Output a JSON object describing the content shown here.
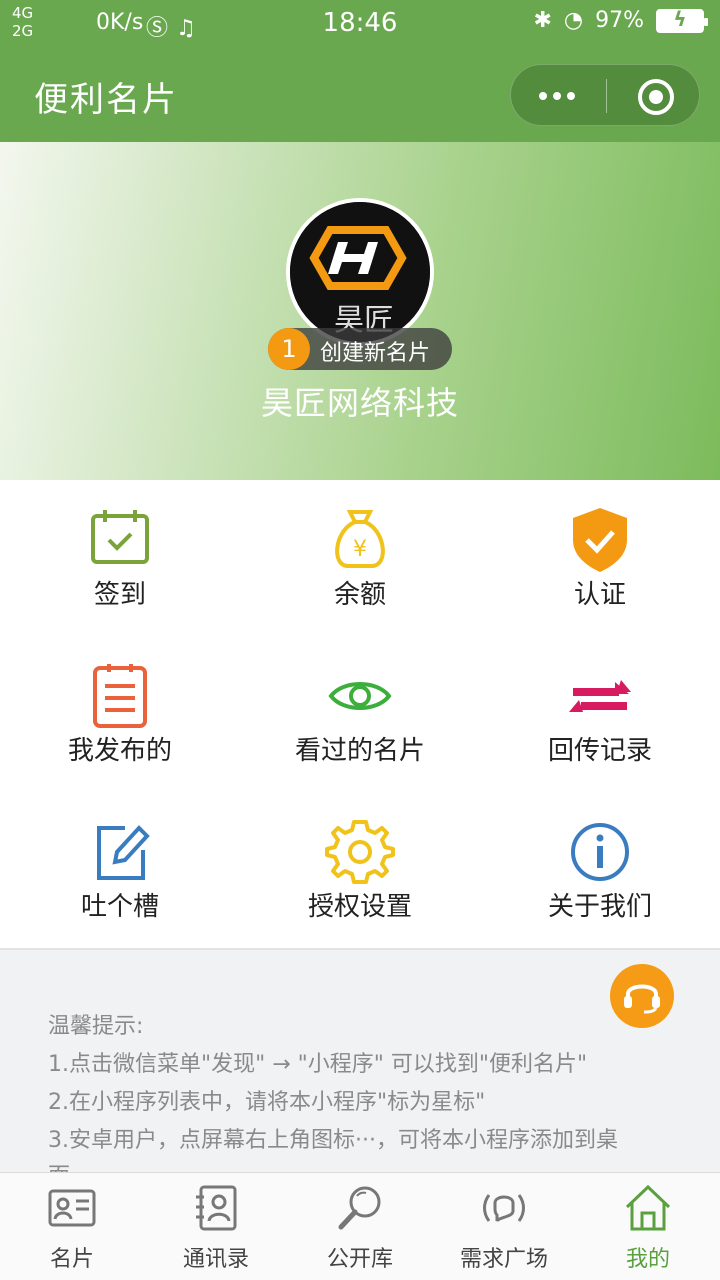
{
  "status_bar": {
    "network_1": "4G",
    "network_2": "2G",
    "speed": "0K/s",
    "time": "18:46",
    "battery": "97%"
  },
  "nav": {
    "title": "便利名片"
  },
  "profile": {
    "create_badge_num": "1",
    "create_label": "创建新名片",
    "company": "昊匠网络科技"
  },
  "menu": {
    "items": [
      {
        "label": "签到",
        "icon": "calendar-check-icon",
        "color": "#7aa33a"
      },
      {
        "label": "余额",
        "icon": "money-bag-icon",
        "color": "#f0c21a"
      },
      {
        "label": "认证",
        "icon": "shield-check-icon",
        "color": "#f39a12"
      },
      {
        "label": "我发布的",
        "icon": "clipboard-list-icon",
        "color": "#e9623b"
      },
      {
        "label": "看过的名片",
        "icon": "eye-icon",
        "color": "#3cae3c"
      },
      {
        "label": "回传记录",
        "icon": "exchange-arrows-icon",
        "color": "#d81b60"
      },
      {
        "label": "吐个槽",
        "icon": "edit-icon",
        "color": "#3a7cc0"
      },
      {
        "label": "授权设置",
        "icon": "gear-icon",
        "color": "#f0c21a"
      },
      {
        "label": "关于我们",
        "icon": "info-icon",
        "color": "#3a7cc0"
      }
    ]
  },
  "tips": {
    "title": "温馨提示:",
    "line1": "1.点击微信菜单\"发现\" → \"小程序\" 可以找到\"便利名片\"",
    "line2": "2.在小程序列表中，请将本小程序\"标为星标\"",
    "line3": "3.安卓用户，点屏幕右上角图标···，可将本小程序添加到桌",
    "line4": "面"
  },
  "tabbar": {
    "items": [
      {
        "label": "名片",
        "icon": "card-icon"
      },
      {
        "label": "通讯录",
        "icon": "contacts-icon"
      },
      {
        "label": "公开库",
        "icon": "search-icon"
      },
      {
        "label": "需求广场",
        "icon": "broadcast-icon"
      },
      {
        "label": "我的",
        "icon": "home-icon",
        "active": true
      }
    ]
  }
}
